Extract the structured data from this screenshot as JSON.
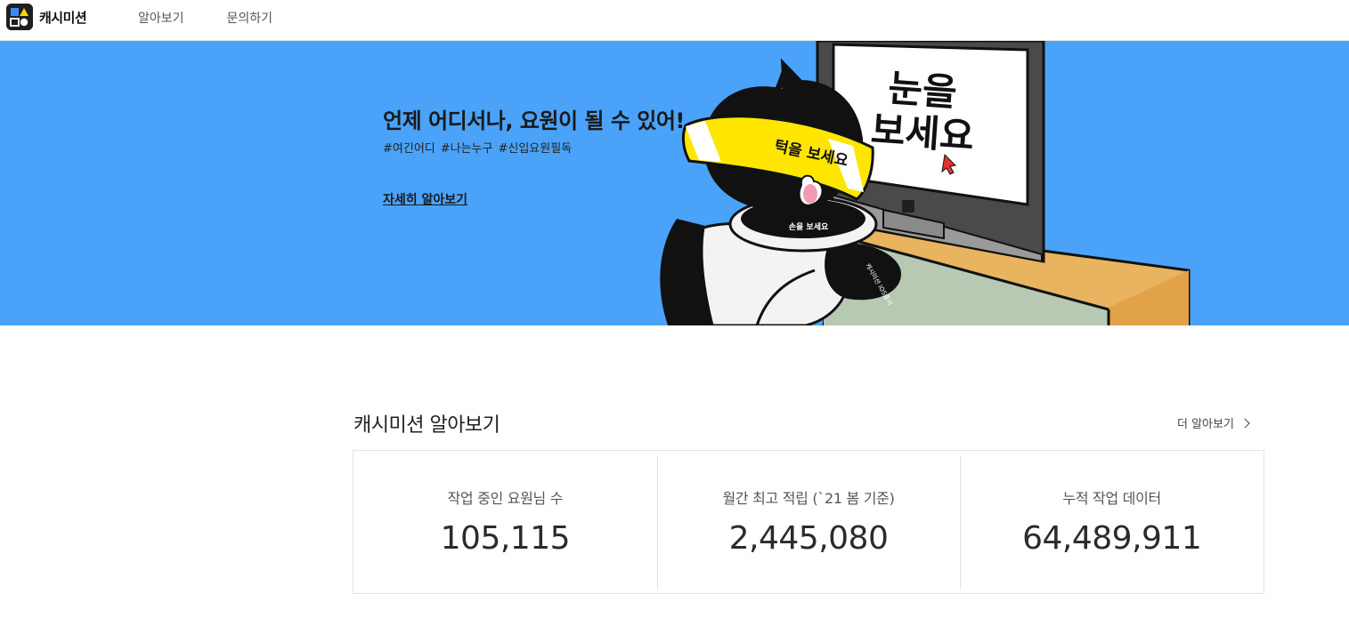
{
  "header": {
    "logo_text": "캐시미션",
    "nav": [
      {
        "label": "알아보기"
      },
      {
        "label": "문의하기"
      }
    ]
  },
  "hero": {
    "title": "언제 어디서나, 요원이 될 수 있어!",
    "tags": [
      "#여긴어디",
      "#나는누구",
      "#신입요원필독"
    ],
    "cta": "자세히 알아보기",
    "art": {
      "monitor_text_line1": "눈을",
      "monitor_text_line2": "보세요",
      "visor_text": "턱을 보세요",
      "collar_text": "손을 보세요",
      "paw_text": "캐시미션 iOS출시"
    }
  },
  "stats_section": {
    "title": "캐시미션 알아보기",
    "more_label": "더 알아보기",
    "items": [
      {
        "label": "작업 중인 요원님 수",
        "value": "105,115"
      },
      {
        "label": "월간 최고 적립 (`21 봄 기준)",
        "value": "2,445,080"
      },
      {
        "label": "누적 작업 데이터",
        "value": "64,489,911"
      }
    ]
  },
  "colors": {
    "hero_bg": "#4aa3f9",
    "visor_yellow": "#ffe600",
    "desk_orange": "#e9b45f",
    "cursor_red": "#e63232"
  }
}
